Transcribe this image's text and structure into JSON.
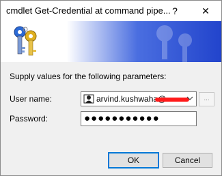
{
  "window": {
    "title": "cmdlet Get-Credential at command pipe...",
    "help_glyph": "?",
    "close_glyph": "✕"
  },
  "prompt": "Supply values for the following parameters:",
  "fields": {
    "username_label": "User name:",
    "username_value": "arvind.kushwaha@",
    "password_label": "Password:",
    "password_value": "●●●●●●●●●●●"
  },
  "buttons": {
    "browse": "...",
    "ok": "OK",
    "cancel": "Cancel"
  },
  "icons": {
    "banner": "keys-icon",
    "user": "user-account-icon",
    "dropdown": "chevron-down-icon"
  },
  "colors": {
    "banner_blue": "#2244cc",
    "ok_border": "#0078d7",
    "redaction": "#ff1a1a"
  }
}
